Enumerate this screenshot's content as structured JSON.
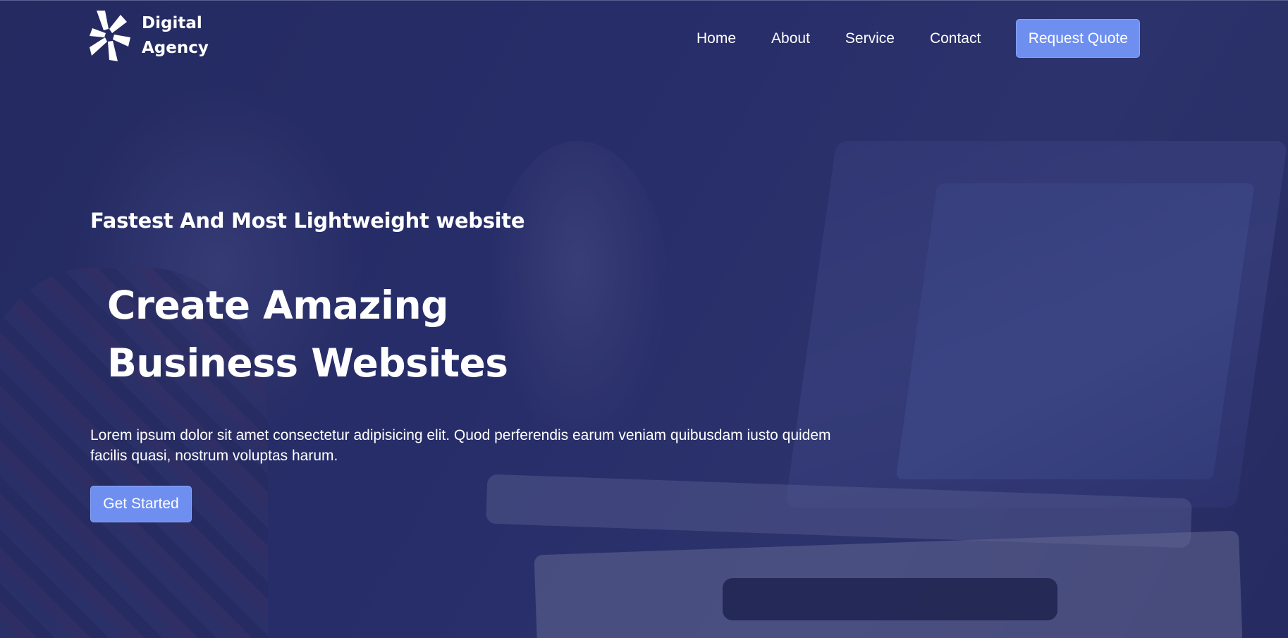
{
  "brand": {
    "line1": "Digital",
    "line2": "Agency",
    "logo_icon": "pinwheel-logo-icon"
  },
  "nav": {
    "items": [
      {
        "label": "Home"
      },
      {
        "label": "About"
      },
      {
        "label": "Service"
      },
      {
        "label": "Contact"
      }
    ],
    "cta_label": "Request Quote"
  },
  "hero": {
    "tagline": "Fastest And Most Lightweight website",
    "headline_line1": "Create Amazing",
    "headline_line2": "Business Websites",
    "lead": "Lorem ipsum dolor sit amet consectetur adipisicing elit. Quod perferendis earum veniam quibusdam iusto quidem facilis quasi, nostrum voluptas harum.",
    "cta_label": "Get Started"
  },
  "colors": {
    "accent": "#6e8ff0",
    "overlay": "#20265c",
    "text": "#ffffff"
  }
}
